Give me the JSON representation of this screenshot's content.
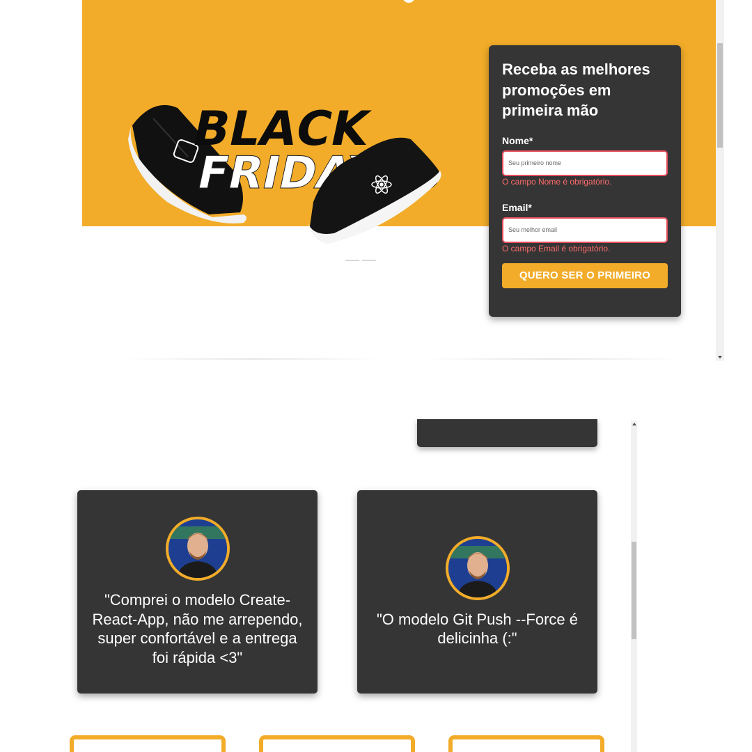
{
  "hero": {
    "headline_line1": "BLACK",
    "headline_line2": "FRIDAY",
    "shoe_logos": [
      "nodejs-icon",
      "react-icon"
    ]
  },
  "signup": {
    "title": "Receba as melhores promoções em primeira mão",
    "name_label": "Nome*",
    "name_placeholder": "Seu primeiro nome",
    "name_value": "",
    "name_error": "O campo Nome é obrigatório.",
    "email_label": "Email*",
    "email_placeholder": "Seu melhor email",
    "email_value": "",
    "email_error": "O campo Email é obrigatório.",
    "submit_label": "QUERO SER O PRIMEIRO"
  },
  "testimonials": [
    {
      "quote": "\"Comprei o modelo Create-React-App, não me arrependo, super confortável e a entrega foi rápida <3\""
    },
    {
      "quote": "\"O modelo Git Push --Force é delicinha (:\""
    }
  ],
  "colors": {
    "accent": "#f2ac29",
    "card": "#353535",
    "error": "#ff6b6b"
  }
}
